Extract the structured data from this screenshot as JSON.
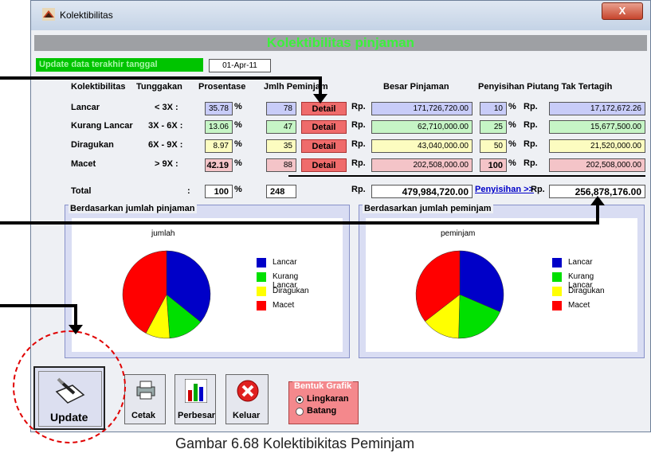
{
  "window": {
    "title": "Kolektibilitas",
    "close": "X"
  },
  "banner": "Kolektibilitas pinjaman",
  "update": {
    "label": "Update data terakhir tanggal",
    "date": "01-Apr-11"
  },
  "headers": {
    "kol": "Kolektibilitas",
    "tung": "Tunggakan",
    "pros": "Prosentase",
    "jmlh": "Jmlh Peminjam",
    "besar": "Besar Pinjaman",
    "penyisihan": "Penyisihan Piutang Tak Tertagih"
  },
  "rows": [
    {
      "name": "Lancar",
      "tung": "< 3X :",
      "pros": "35.78",
      "count": "78",
      "detail": "Detail",
      "rp": "Rp.",
      "amount": "171,726,720.00",
      "pct": "10",
      "rp2": "Rp.",
      "prov": "17,172,672.26",
      "color": "#c8ccf8"
    },
    {
      "name": "Kurang Lancar",
      "tung": "3X - 6X :",
      "pros": "13.06",
      "count": "47",
      "detail": "Detail",
      "rp": "Rp.",
      "amount": "62,710,000.00",
      "pct": "25",
      "rp2": "Rp.",
      "prov": "15,677,500.00",
      "color": "#c6f5c6"
    },
    {
      "name": "Diragukan",
      "tung": "6X - 9X :",
      "pros": "8.97",
      "count": "35",
      "detail": "Detail",
      "rp": "Rp.",
      "amount": "43,040,000.00",
      "pct": "50",
      "rp2": "Rp.",
      "prov": "21,520,000.00",
      "color": "#fcfcc0"
    },
    {
      "name": "Macet",
      "tung": "> 9X :",
      "pros": "42.19",
      "count": "88",
      "detail": "Detail",
      "rp": "Rp.",
      "amount": "202,508,000.00",
      "pct": "100",
      "rp2": "Rp.",
      "prov": "202,508,000.00",
      "color": "#f4c4c8"
    }
  ],
  "percent_sign": "%",
  "total": {
    "label": "Total",
    "colon": ":",
    "pros": "100",
    "count": "248",
    "rp": "Rp.",
    "amount": "479,984,720.00",
    "penyisihan_link": "Penyisihan >>",
    "rp2": "Rp.",
    "prov": "256,878,176.00"
  },
  "charts": {
    "left": {
      "panel_title": "Berdasarkan jumlah pinjaman",
      "chart_title": "jumlah"
    },
    "right": {
      "panel_title": "Berdasarkan jumlah peminjam",
      "chart_title": "peminjam"
    }
  },
  "chart_data": [
    {
      "type": "pie",
      "title": "jumlah",
      "categories": [
        "Lancar",
        "Kurang Lancar",
        "Diragukan",
        "Macet"
      ],
      "values": [
        35.78,
        13.06,
        8.97,
        42.19
      ],
      "colors": [
        "#0000c8",
        "#00e000",
        "#ffff00",
        "#ff0000"
      ],
      "legend": "right"
    },
    {
      "type": "pie",
      "title": "peminjam",
      "categories": [
        "Lancar",
        "Kurang Lancar",
        "Diragukan",
        "Macet"
      ],
      "values": [
        31.45,
        18.95,
        14.11,
        35.48
      ],
      "colors": [
        "#0000c8",
        "#00e000",
        "#ffff00",
        "#ff0000"
      ],
      "legend": "right"
    }
  ],
  "buttons": {
    "update": "Update",
    "cetak": "Cetak",
    "perbesar": "Perbesar",
    "keluar": "Keluar"
  },
  "bentuk": {
    "title": "Bentuk Grafik",
    "opt1": "Lingkaran",
    "opt2": "Batang",
    "selected": "Lingkaran"
  },
  "caption": "Gambar 6.68 Kolektibikitas Peminjam"
}
